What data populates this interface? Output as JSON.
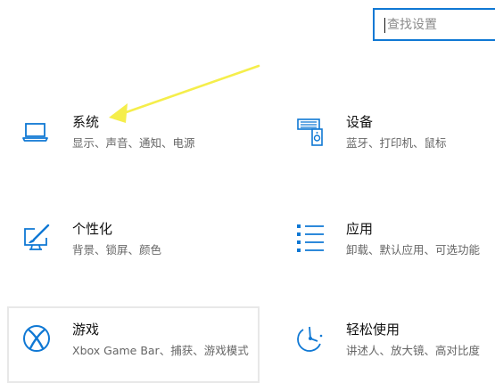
{
  "search": {
    "placeholder": "查找设置"
  },
  "categories": [
    {
      "title": "系统",
      "description": "显示、声音、通知、电源",
      "icon": "laptop-icon"
    },
    {
      "title": "设备",
      "description": "蓝牙、打印机、鼠标",
      "icon": "devices-icon"
    },
    {
      "title": "个性化",
      "description": "背景、锁屏、颜色",
      "icon": "personalization-icon"
    },
    {
      "title": "应用",
      "description": "卸载、默认应用、可选功能",
      "icon": "apps-icon"
    },
    {
      "title": "游戏",
      "description": "Xbox Game Bar、捕获、游戏模式",
      "icon": "xbox-icon"
    },
    {
      "title": "轻松使用",
      "description": "讲述人、放大镜、高对比度",
      "icon": "ease-of-access-icon"
    }
  ],
  "colors": {
    "accent": "#0f78d4",
    "annotation_arrow": "#f5ee4b"
  }
}
